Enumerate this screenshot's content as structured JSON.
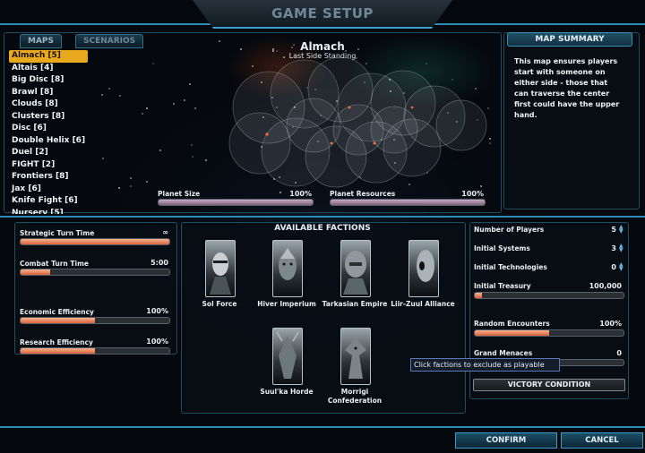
{
  "window": {
    "title": "GAME SETUP"
  },
  "tabs": [
    {
      "label": "MAPS",
      "active": true
    },
    {
      "label": "SCENARIOS",
      "active": false
    }
  ],
  "maps": {
    "selected_index": 0,
    "items": [
      "Almach [5]",
      "Altais [4]",
      "Big Disc [8]",
      "Brawl [8]",
      "Clouds [8]",
      "Clusters [8]",
      "Disc [6]",
      "Double Helix [6]",
      "Duel [2]",
      "FIGHT [2]",
      "Frontiers [8]",
      "Jax [6]",
      "Knife Fight [6]",
      "Nursery [5]"
    ]
  },
  "map_view": {
    "name": "Almach",
    "subtitle": "Last Side Standing",
    "planet_size": {
      "label": "Planet Size",
      "value": "100%",
      "level": 1.0
    },
    "planet_resources": {
      "label": "Planet Resources",
      "value": "100%",
      "level": 1.0
    }
  },
  "summary": {
    "header": "MAP SUMMARY",
    "text": "This map ensures players start with someone on either side - those that can traverse the center first could have the upper hand."
  },
  "left_settings": [
    {
      "label": "Strategic Turn Time",
      "value": "∞",
      "level": 1.0
    },
    {
      "label": "Combat Turn Time",
      "value": "5:00",
      "level": 0.2
    },
    {
      "label": "Economic Efficiency",
      "value": "100%",
      "level": 0.5
    },
    {
      "label": "Research Efficiency",
      "value": "100%",
      "level": 0.5
    }
  ],
  "factions": {
    "header": "AVAILABLE FACTIONS",
    "items": [
      {
        "name": "Sol Force"
      },
      {
        "name": "Hiver Imperium"
      },
      {
        "name": "Tarkasian Empire"
      },
      {
        "name": "Liir-Zuul Alliance"
      },
      {
        "name": "Suul'ka Horde"
      },
      {
        "name": "Morrigi Confederation"
      }
    ],
    "tooltip": "Click factions to exclude as playable"
  },
  "right_settings": {
    "num_players": {
      "label": "Number of Players",
      "value": "5"
    },
    "initial_systems": {
      "label": "Initial Systems",
      "value": "3"
    },
    "initial_technologies": {
      "label": "Initial Technologies",
      "value": "0"
    },
    "initial_treasury": {
      "label": "Initial Treasury",
      "value": "100,000",
      "level": 0.05
    },
    "random_encounters": {
      "label": "Random Encounters",
      "value": "100%",
      "level": 0.5
    },
    "grand_menaces": {
      "label": "Grand Menaces",
      "value": "0",
      "level": 0.0
    },
    "victory_label": "VICTORY CONDITION"
  },
  "buttons": {
    "confirm": "CONFIRM",
    "cancel": "CANCEL"
  },
  "colors": {
    "accent": "#2b8db5",
    "selected": "#e8a91e",
    "bar_fill": "#e07a52"
  }
}
